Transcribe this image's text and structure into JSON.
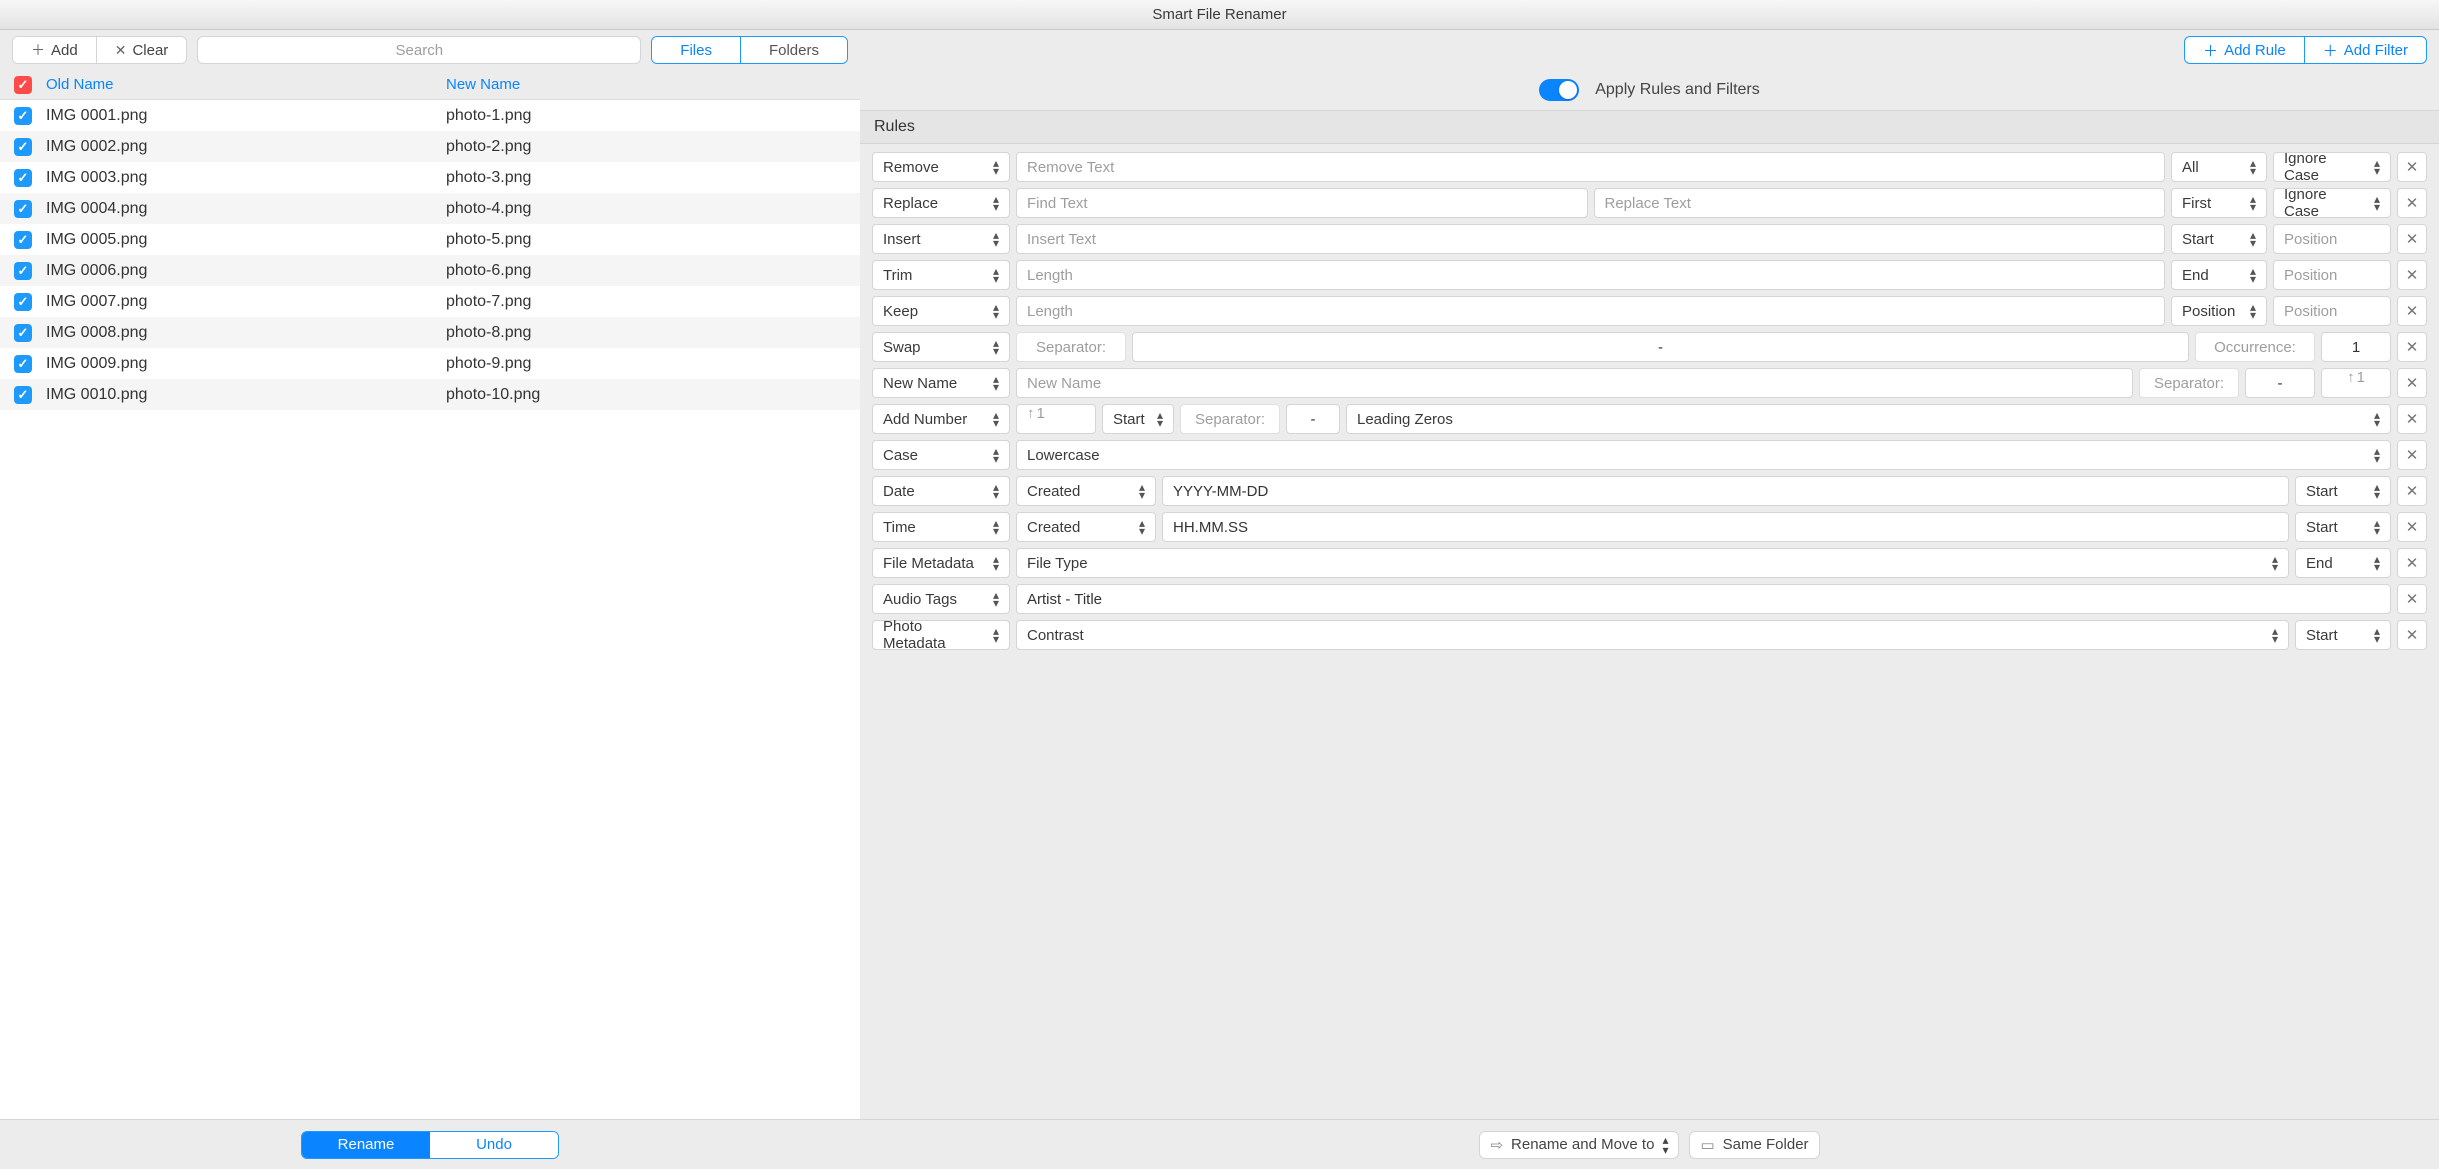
{
  "app_title": "Smart File Renamer",
  "left_toolbar": {
    "add": "Add",
    "clear": "Clear",
    "search_placeholder": "Search",
    "seg_files": "Files",
    "seg_folders": "Folders"
  },
  "table": {
    "header_old": "Old Name",
    "header_new": "New Name",
    "rows": [
      {
        "old": "IMG 0001.png",
        "new": "photo-1.png"
      },
      {
        "old": "IMG 0002.png",
        "new": "photo-2.png"
      },
      {
        "old": "IMG 0003.png",
        "new": "photo-3.png"
      },
      {
        "old": "IMG 0004.png",
        "new": "photo-4.png"
      },
      {
        "old": "IMG 0005.png",
        "new": "photo-5.png"
      },
      {
        "old": "IMG 0006.png",
        "new": "photo-6.png"
      },
      {
        "old": "IMG 0007.png",
        "new": "photo-7.png"
      },
      {
        "old": "IMG 0008.png",
        "new": "photo-8.png"
      },
      {
        "old": "IMG 0009.png",
        "new": "photo-9.png"
      },
      {
        "old": "IMG 0010.png",
        "new": "photo-10.png"
      }
    ]
  },
  "actions": {
    "rename": "Rename",
    "undo": "Undo"
  },
  "right_toolbar": {
    "add_rule": "Add Rule",
    "add_filter": "Add Filter"
  },
  "apply_label": "Apply Rules and Filters",
  "rules_header": "Rules",
  "rules": {
    "remove": {
      "action": "Remove",
      "ph": "Remove Text",
      "scope": "All",
      "case": "Ignore Case"
    },
    "replace": {
      "action": "Replace",
      "ph_find": "Find Text",
      "ph_replace": "Replace Text",
      "scope": "First",
      "case": "Ignore Case"
    },
    "insert": {
      "action": "Insert",
      "ph": "Insert Text",
      "pos": "Start",
      "ph_pos": "Position"
    },
    "trim": {
      "action": "Trim",
      "ph": "Length",
      "pos": "End",
      "ph_pos": "Position"
    },
    "keep": {
      "action": "Keep",
      "ph": "Length",
      "pos": "Position",
      "ph_pos": "Position"
    },
    "swap": {
      "action": "Swap",
      "sep_label": "Separator:",
      "sep_val": "-",
      "occ_label": "Occurrence:",
      "occ_val": "1"
    },
    "newname": {
      "action": "New Name",
      "ph": "New Name",
      "sep_label": "Separator:",
      "sep_val": "-",
      "start": "1"
    },
    "addnum": {
      "action": "Add Number",
      "start": "1",
      "pos": "Start",
      "sep_label": "Separator:",
      "sep_val": "-",
      "lz": "Leading Zeros"
    },
    "case": {
      "action": "Case",
      "value": "Lowercase"
    },
    "date": {
      "action": "Date",
      "src": "Created",
      "fmt": "YYYY-MM-DD",
      "pos": "Start"
    },
    "time": {
      "action": "Time",
      "src": "Created",
      "fmt": "HH.MM.SS",
      "pos": "Start"
    },
    "fmeta": {
      "action": "File Metadata",
      "value": "File Type",
      "pos": "End"
    },
    "atags": {
      "action": "Audio Tags",
      "value": "Artist - Title"
    },
    "pmeta": {
      "action": "Photo Metadata",
      "value": "Contrast",
      "pos": "Start"
    }
  },
  "bottom_right": {
    "move": "Rename and Move to",
    "folder": "Same Folder"
  }
}
